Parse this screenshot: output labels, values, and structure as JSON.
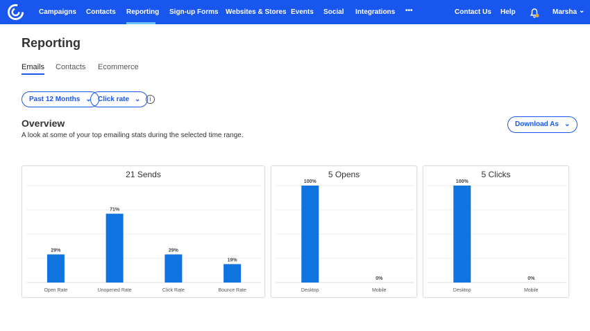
{
  "nav": {
    "items": [
      "Campaigns",
      "Contacts",
      "Reporting",
      "Sign-up Forms",
      "Websites & Stores",
      "Events",
      "Social",
      "Integrations"
    ],
    "more": "•••",
    "contact": "Contact Us",
    "help": "Help",
    "user": "Marsha",
    "active": "Reporting",
    "brand_color": "#1856ed",
    "notification_color": "#f5a623"
  },
  "page": {
    "title": "Reporting",
    "tabs": [
      "Emails",
      "Contacts",
      "Ecommerce"
    ],
    "active_tab": "Emails"
  },
  "filters": {
    "range": "Past 12 Months",
    "metric": "Click rate"
  },
  "overview": {
    "title": "Overview",
    "subtitle": "A look at some of your top emailing stats during the selected time range.",
    "download": "Download As"
  },
  "chart_data": [
    {
      "type": "bar",
      "title": "21 Sends",
      "categories": [
        "Open Rate",
        "Unopened Rate",
        "Click Rate",
        "Bounce Rate"
      ],
      "values": [
        29,
        71,
        29,
        19
      ],
      "labels": [
        "29%",
        "71%",
        "29%",
        "19%"
      ],
      "ylim": [
        0,
        100
      ],
      "grid": true,
      "color": "#0f74e0"
    },
    {
      "type": "bar",
      "title": "5 Opens",
      "categories": [
        "Desktop",
        "Mobile"
      ],
      "values": [
        100,
        0
      ],
      "labels": [
        "100%",
        "0%"
      ],
      "ylim": [
        0,
        100
      ],
      "grid": true,
      "color": "#0f74e0"
    },
    {
      "type": "bar",
      "title": "5 Clicks",
      "categories": [
        "Desktop",
        "Mobile"
      ],
      "values": [
        100,
        0
      ],
      "labels": [
        "100%",
        "0%"
      ],
      "ylim": [
        0,
        100
      ],
      "grid": true,
      "color": "#0f74e0"
    }
  ]
}
